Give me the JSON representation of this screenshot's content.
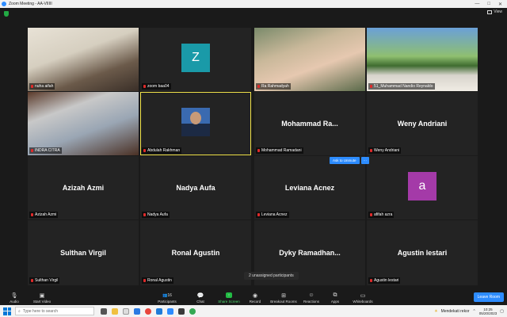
{
  "window": {
    "title": "Zoom Meeting - AA-VIIIII",
    "controls": [
      "—",
      "□",
      "✕"
    ]
  },
  "view_label": "View",
  "tiles": [
    {
      "name": "nuha aifah",
      "type": "video",
      "row": 0,
      "col": 0
    },
    {
      "name": "zoom baa04",
      "type": "avatar",
      "avatar_letter": "Z",
      "avatar_color": "#1a9aa8",
      "row": 0,
      "col": 1
    },
    {
      "name": "Ra Rahmadyah",
      "type": "video",
      "row": 0,
      "col": 2
    },
    {
      "name": "51_Muhammad Nandio Reynaldo",
      "type": "video",
      "row": 0,
      "col": 3
    },
    {
      "name": "INDRA CITRA",
      "type": "video",
      "row": 1,
      "col": 0
    },
    {
      "name": "Abdulah Rakhman",
      "type": "photo",
      "row": 1,
      "col": 1,
      "active": true
    },
    {
      "name": "Mohammad Ramadani",
      "type": "name",
      "display": "Mohammad  Ra...",
      "row": 1,
      "col": 2
    },
    {
      "name": "Weny Andriani",
      "type": "name",
      "display": "Weny Andriani",
      "row": 1,
      "col": 3
    },
    {
      "name": "Azizah Azmi",
      "type": "name",
      "display": "Azizah Azmi",
      "row": 2,
      "col": 0
    },
    {
      "name": "Nadya Aufa",
      "type": "name",
      "display": "Nadya Aufa",
      "row": 2,
      "col": 1
    },
    {
      "name": "Leviana Acnez",
      "type": "name",
      "display": "Leviana Acnez",
      "row": 2,
      "col": 2
    },
    {
      "name": "afifah azra",
      "type": "avatar",
      "avatar_letter": "a",
      "avatar_color": "#a43aa8",
      "row": 2,
      "col": 3
    },
    {
      "name": "Sulthan Virgil",
      "type": "name",
      "display": "Sulthan Virgil",
      "row": 3,
      "col": 0
    },
    {
      "name": "Ronal Agustin",
      "type": "name",
      "display": "Ronal Agustin",
      "row": 3,
      "col": 1
    },
    {
      "name": "Dyky Ramadhan",
      "type": "name",
      "display": "Dyky  Ramadhan...",
      "row": 3,
      "col": 2,
      "hide_label": true
    },
    {
      "name": "Agustin lestari",
      "type": "name",
      "display": "Agustin lestari",
      "row": 3,
      "col": 3
    }
  ],
  "ask_unmute": {
    "label": "Ask to Unmute",
    "more": "···"
  },
  "unassigned": "2 unassigned participants",
  "toolbar": {
    "audio": "Audio",
    "video": "Start Video",
    "participants": "Participants",
    "participant_count": "16",
    "chat": "Chat",
    "share": "Share Screen",
    "record": "Record",
    "breakout": "Breakout Rooms",
    "reactions": "Reactions",
    "apps": "Apps",
    "whiteboards": "Whiteboards",
    "leave": "Leave Room"
  },
  "taskbar": {
    "search_placeholder": "Type here to search",
    "weather": "Mendekati rekor",
    "time": "10:25",
    "date": "05/20/2023"
  },
  "colors": {
    "zoom_blue": "#2d8cff",
    "share_green": "#22bb44",
    "active_speaker": "#f2e34a",
    "muted_red": "#e02a2a"
  }
}
